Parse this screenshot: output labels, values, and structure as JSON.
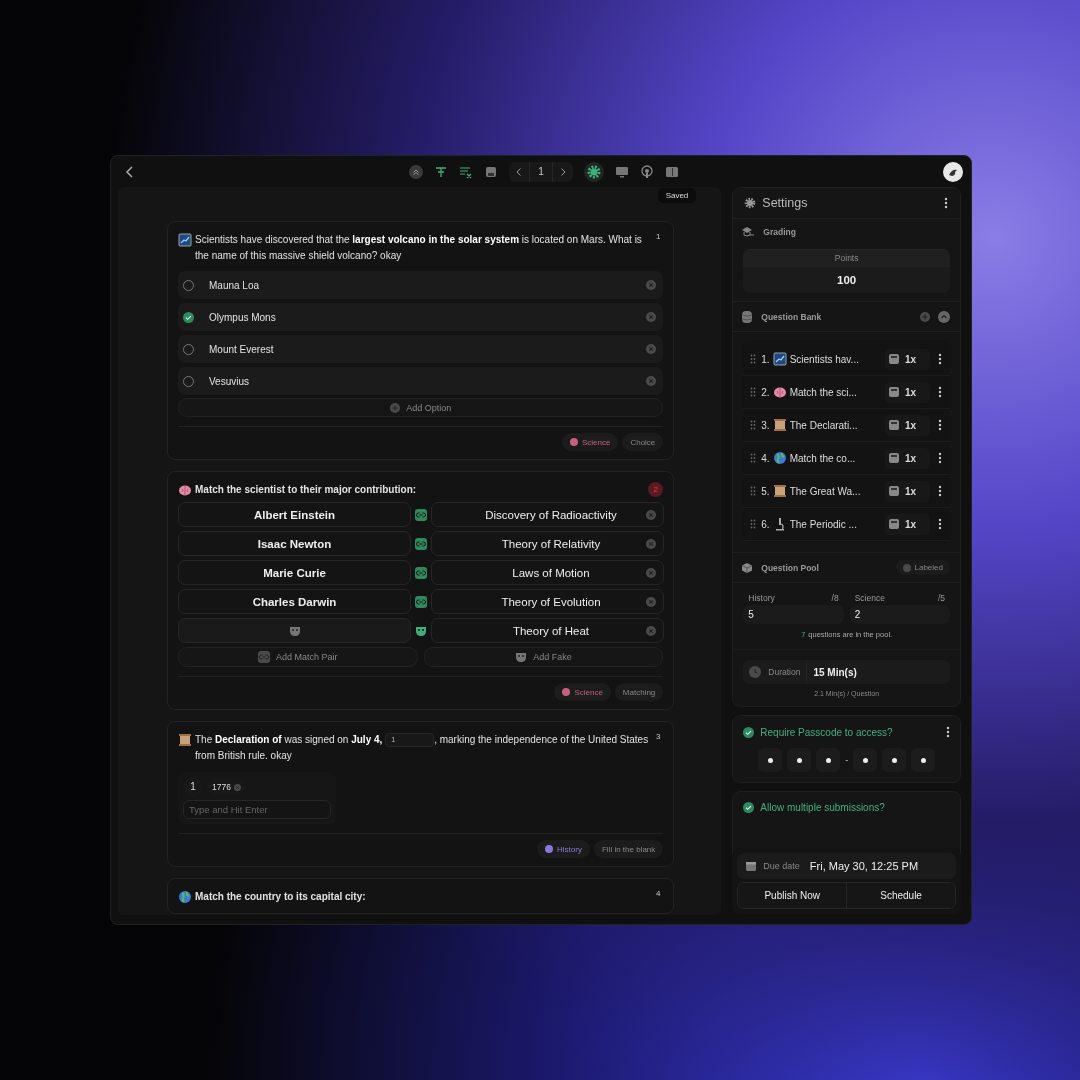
{
  "toolbar": {
    "page": "1",
    "saved_label": "Saved"
  },
  "questions": [
    {
      "kind": "choice",
      "number": "1",
      "flagged": false,
      "prompt": "Scientists have discovered that the **largest volcano in the solar system** is located on Mars. What is the name of this massive shield volcano? okay",
      "options": [
        {
          "label": "Mauna Loa",
          "selected": false
        },
        {
          "label": "Olympus Mons",
          "selected": true
        },
        {
          "label": "Mount Everest",
          "selected": false
        },
        {
          "label": "Vesuvius",
          "selected": false
        }
      ],
      "add_label": "Add Option",
      "tag": {
        "label": "Science",
        "color": "#c8607f"
      },
      "type_label": "Choice"
    },
    {
      "kind": "matching",
      "number": "2",
      "flagged": true,
      "prompt": "Match the scientist to their major contribution:",
      "pairs": [
        {
          "left": "Albert Einstein",
          "right": "Discovery of Radioactivity"
        },
        {
          "left": "Isaac Newton",
          "right": "Theory of Relativity"
        },
        {
          "left": "Marie Curie",
          "right": "Laws of Motion"
        },
        {
          "left": "Charles Darwin",
          "right": "Theory of Evolution"
        }
      ],
      "fakes": [
        {
          "right": "Theory of Heat"
        }
      ],
      "add_pair_label": "Add Match Pair",
      "add_fake_label": "Add Fake",
      "tag": {
        "label": "Science",
        "color": "#c8607f"
      },
      "type_label": "Matching"
    },
    {
      "kind": "blank",
      "number": "3",
      "flagged": false,
      "prompt_before": "The **Declaration of** was signed on **July 4,**",
      "blank": "1",
      "prompt_after": ", marking the independence of the United States from British rule. okay",
      "answer_groups": [
        {
          "blank": "1",
          "answers": [
            "1776"
          ],
          "placeholder": "Type and Hit Enter"
        }
      ],
      "tag": {
        "label": "History",
        "color": "#8c78d8"
      },
      "type_label": "Fill in the blank"
    },
    {
      "kind": "matching",
      "number": "4",
      "flagged": false,
      "prompt": "Match the country to its capital city:"
    }
  ],
  "settings": {
    "title": "Settings",
    "grading_label": "Grading",
    "points_label": "Points",
    "points": "100",
    "bank": {
      "title": "Question Bank",
      "items": [
        {
          "number": "1.",
          "title": "Scientists hav...",
          "weight": "1x"
        },
        {
          "number": "2.",
          "title": "Match the sci...",
          "weight": "1x"
        },
        {
          "number": "3.",
          "title": "The Declarati...",
          "weight": "1x"
        },
        {
          "number": "4.",
          "title": "Match the co...",
          "weight": "1x"
        },
        {
          "number": "5.",
          "title": "The Great Wa...",
          "weight": "1x"
        },
        {
          "number": "6.",
          "title": "The Periodic ...",
          "weight": "1x"
        }
      ]
    },
    "pool": {
      "title": "Question Pool",
      "badge": "Labeled",
      "categories": [
        {
          "name": "History",
          "max": "/8",
          "value": "5"
        },
        {
          "name": "Science",
          "max": "/5",
          "value": "2"
        }
      ],
      "count": "7",
      "summary": "questions are in the pool."
    },
    "duration": {
      "label": "Duration",
      "value": "15 Min(s)",
      "per_question": "2.1 Min(s) / Question"
    },
    "passcode": {
      "label": "Require Passcode to access?",
      "checked": true,
      "separator": "-",
      "digits": [
        {
          "filled": true
        },
        {
          "filled": true
        },
        {
          "filled": true
        },
        {
          "filled": true
        },
        {
          "filled": true
        },
        {
          "filled": true
        }
      ]
    },
    "multiple": {
      "label": "Allow multiple submissions?",
      "checked": true
    },
    "due": {
      "label": "Due date",
      "value": "Fri, May 30, 12:25 PM"
    },
    "buttons": [
      "Publish Now",
      "Schedule"
    ]
  }
}
